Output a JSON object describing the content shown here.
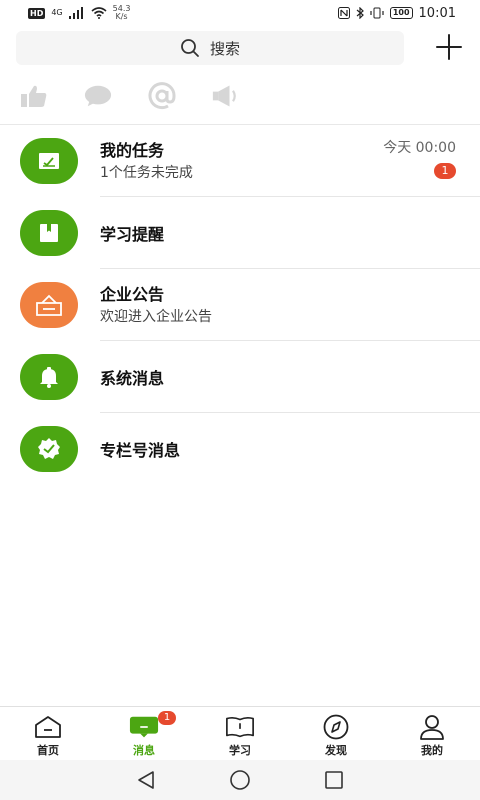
{
  "status_bar": {
    "hd": "HD",
    "network": "4G",
    "speed_value": "54.3",
    "speed_unit": "K/s",
    "battery": "100",
    "time": "10:01"
  },
  "search": {
    "label": "搜索"
  },
  "quick_icons": [
    "thumbs-up-icon",
    "chat-bubble-icon",
    "at-sign-icon",
    "speaker-icon"
  ],
  "messages": [
    {
      "title": "我的任务",
      "subtitle": "1个任务未完成",
      "time": "今天 00:00",
      "badge": "1",
      "icon": "task-check-icon",
      "color": "#4ca612"
    },
    {
      "title": "学习提醒",
      "subtitle": "",
      "icon": "bookmark-icon",
      "color": "#4ca612"
    },
    {
      "title": "企业公告",
      "subtitle": "欢迎进入企业公告",
      "icon": "announcement-icon",
      "color": "#f08040"
    },
    {
      "title": "系统消息",
      "subtitle": "",
      "icon": "bell-icon",
      "color": "#4ca612"
    },
    {
      "title": "专栏号消息",
      "subtitle": "",
      "icon": "verified-badge-icon",
      "color": "#4ca612"
    }
  ],
  "bottom_nav": [
    {
      "label": "首页",
      "icon": "home-icon",
      "active": false
    },
    {
      "label": "消息",
      "icon": "message-icon",
      "active": true,
      "badge": "1"
    },
    {
      "label": "学习",
      "icon": "book-icon",
      "active": false
    },
    {
      "label": "发现",
      "icon": "compass-icon",
      "active": false
    },
    {
      "label": "我的",
      "icon": "user-icon",
      "active": false
    }
  ],
  "colors": {
    "accent": "#4ca612",
    "orange": "#f08040",
    "badge": "#e64a2e"
  }
}
